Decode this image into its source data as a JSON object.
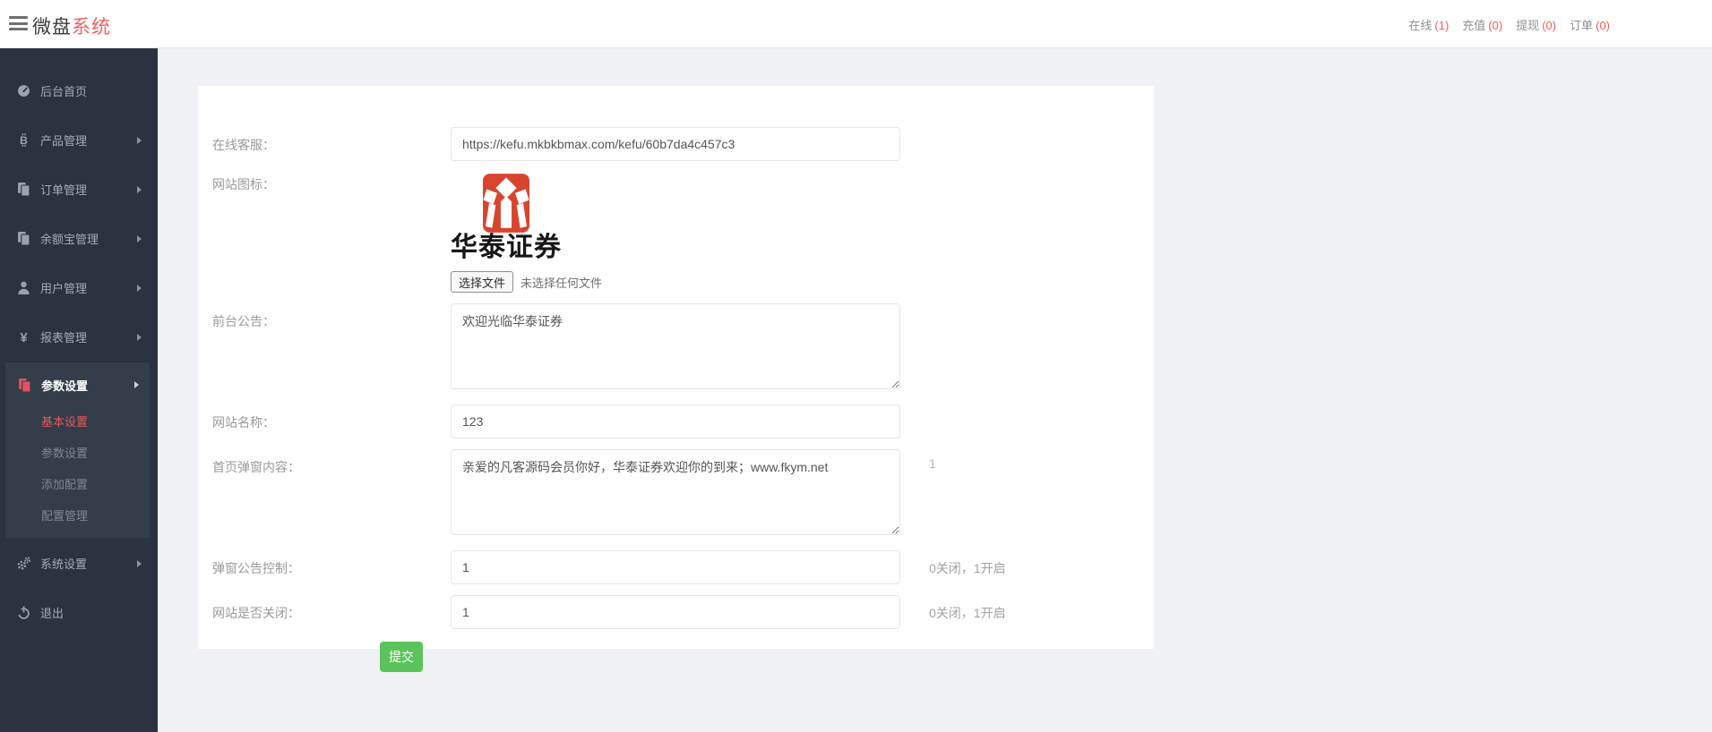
{
  "header": {
    "brand": {
      "part1": "微盘",
      "part2": "系统"
    },
    "nav": [
      {
        "label": "在线",
        "count": "(1)"
      },
      {
        "label": "充值",
        "count": "(0)"
      },
      {
        "label": "提现",
        "count": "(0)"
      },
      {
        "label": "订单",
        "count": "(0)"
      }
    ]
  },
  "sidebar": {
    "items": [
      {
        "label": "后台首页"
      },
      {
        "label": "产品管理"
      },
      {
        "label": "订单管理"
      },
      {
        "label": "余额宝管理"
      },
      {
        "label": "用户管理"
      },
      {
        "label": "报表管理"
      },
      {
        "label": "参数设置"
      },
      {
        "label": "系统设置"
      },
      {
        "label": "退出"
      }
    ],
    "submenu": [
      {
        "label": "基本设置",
        "active": true
      },
      {
        "label": "参数设置"
      },
      {
        "label": "添加配置"
      },
      {
        "label": "配置管理"
      }
    ]
  },
  "form": {
    "online_service": {
      "label": "在线客服：",
      "value": "https://kefu.mkbkbmax.com/kefu/60b7da4c457c3"
    },
    "site_icon": {
      "label": "网站图标：",
      "logo_caption": "华泰证券",
      "file_button": "选择文件",
      "file_status": "未选择任何文件"
    },
    "front_notice": {
      "label": "前台公告：",
      "value": "欢迎光临华泰证券"
    },
    "site_name": {
      "label": "网站名称：",
      "value": "123"
    },
    "popup_content": {
      "label": "首页弹窗内容：",
      "value": "亲爱的凡客源码会员你好，华泰证券欢迎你的到来；www.fkym.net",
      "hint": "1"
    },
    "popup_control": {
      "label": "弹窗公告控制：",
      "value": "1",
      "hint": "0关闭，1开启"
    },
    "site_closed": {
      "label": "网站是否关闭：",
      "value": "1",
      "hint": "0关闭，1开启"
    },
    "submit_label": "提交"
  },
  "colors": {
    "accent_red": "#f25b5b",
    "sidebar_bg": "#2a333f",
    "sidebar_active_icon": "#e0535e",
    "submit_green": "#5bc35b",
    "huatai_red": "#d9442e",
    "main_bg": "#eff1f5"
  }
}
